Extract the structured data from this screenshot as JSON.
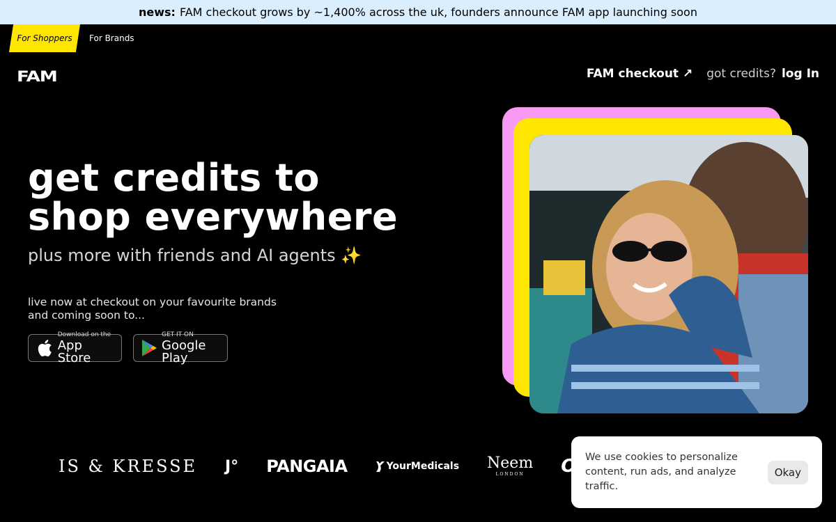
{
  "news": {
    "prefix": "news:",
    "text": "FAM checkout grows by ~1,400% across the uk, founders announce FAM app launching soon"
  },
  "audience_tabs": {
    "shoppers": "For Shoppers",
    "brands": "For Brands"
  },
  "logo": "FAM",
  "nav": {
    "checkout": "FAM checkout ↗",
    "credits": "got credits?",
    "login": "log In"
  },
  "hero": {
    "headline_line1": "get credits to",
    "headline_line2": "shop everywhere",
    "subhead": "plus more with friends and AI agents ✨",
    "live_line1": "live now at checkout on your favourite brands",
    "live_line2": "and coming soon to..."
  },
  "store_buttons": {
    "appstore_small": "Download on the",
    "appstore_big": "App Store",
    "gplay_small": "GET IT ON",
    "gplay_big": "Google Play"
  },
  "brands": {
    "kresse": "IS & KRESSE",
    "jo": "J°",
    "pangaia": "PANGAIA",
    "yourmedicals": "YourMedicals",
    "neem": "Neem",
    "neem_sub": "LONDON",
    "olive": "OLIVE"
  },
  "cookie": {
    "text": "We use cookies to personalize content, run ads, and analyze traffic.",
    "ok": "Okay"
  },
  "colors": {
    "news_bg": "#dbeefd",
    "accent_yellow": "#ffe600",
    "accent_pink": "#f799f3",
    "background": "#000000"
  },
  "icons": [
    "apple-icon",
    "google-play-icon"
  ]
}
